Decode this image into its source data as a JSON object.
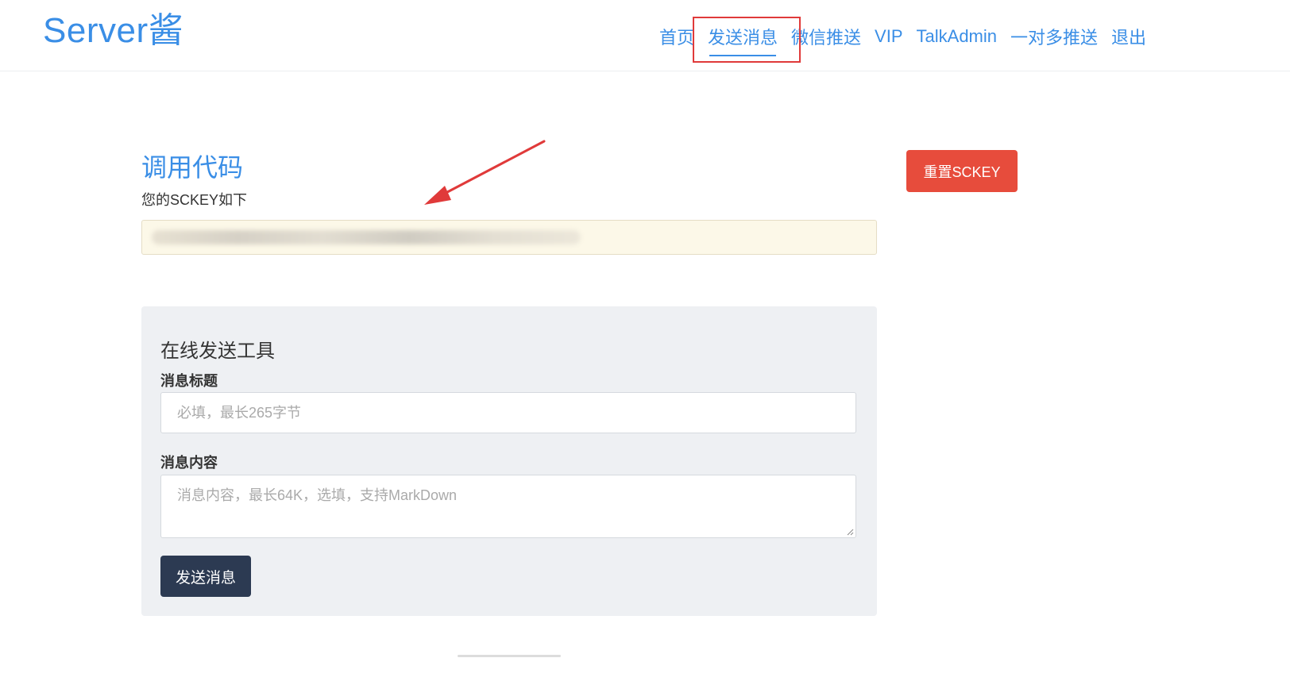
{
  "header": {
    "logo": "Server酱",
    "nav": [
      {
        "label": "首页"
      },
      {
        "label": "发送消息",
        "active": true
      },
      {
        "label": "微信推送"
      },
      {
        "label": "VIP"
      },
      {
        "label": "TalkAdmin"
      },
      {
        "label": "一对多推送"
      },
      {
        "label": "退出"
      }
    ]
  },
  "main": {
    "title": "调用代码",
    "subtitle": "您的SCKEY如下",
    "reset_button": "重置SCKEY"
  },
  "tool": {
    "title": "在线发送工具",
    "title_label": "消息标题",
    "title_placeholder": "必填，最长265字节",
    "content_label": "消息内容",
    "content_placeholder": "消息内容，最长64K，选填，支持MarkDown",
    "send_button": "发送消息"
  },
  "colors": {
    "accent": "#3a8ee6",
    "danger": "#e74c3c",
    "dark_button": "#2c3a52",
    "annotation": "#e03a3a"
  }
}
